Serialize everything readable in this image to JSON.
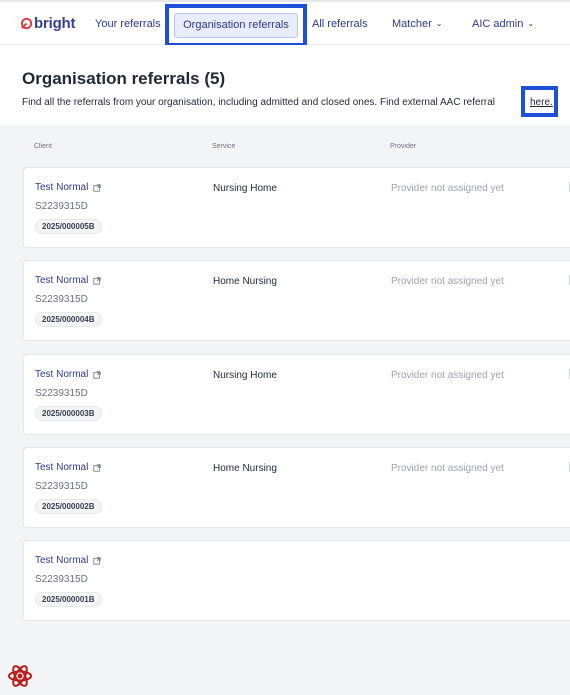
{
  "brand": {
    "name": "bright"
  },
  "nav": {
    "your_referrals": "Your referrals",
    "organisation_referrals": "Organisation referrals",
    "all_referrals": "All referrals",
    "matcher": "Matcher",
    "aic_admin": "AIC admin"
  },
  "header": {
    "title": "Organisation referrals (5)",
    "description": "Find all the referrals from your organisation, including admitted and closed ones. Find external AAC referral",
    "link": "here."
  },
  "columns": {
    "client": "Client",
    "service": "Service",
    "provider": "Provider"
  },
  "referrals": [
    {
      "client": "Test Normal",
      "id": "S2239315D",
      "ref": "2025/000005B",
      "service": "Nursing Home",
      "provider": "Provider not assigned yet"
    },
    {
      "client": "Test Normal",
      "id": "S2239315D",
      "ref": "2025/000004B",
      "service": "Home Nursing",
      "provider": "Provider not assigned yet"
    },
    {
      "client": "Test Normal",
      "id": "S2239315D",
      "ref": "2025/000003B",
      "service": "Nursing Home",
      "provider": "Provider not assigned yet"
    },
    {
      "client": "Test Normal",
      "id": "S2239315D",
      "ref": "2025/000002B",
      "service": "Home Nursing",
      "provider": "Provider not assigned yet"
    },
    {
      "client": "Test Normal",
      "id": "S2239315D",
      "ref": "2025/000001B",
      "service": "",
      "provider": ""
    }
  ],
  "colors": {
    "brand_red": "#e0373d",
    "nav_blue": "#2d3a8c",
    "highlight": "#1d4fd8"
  }
}
